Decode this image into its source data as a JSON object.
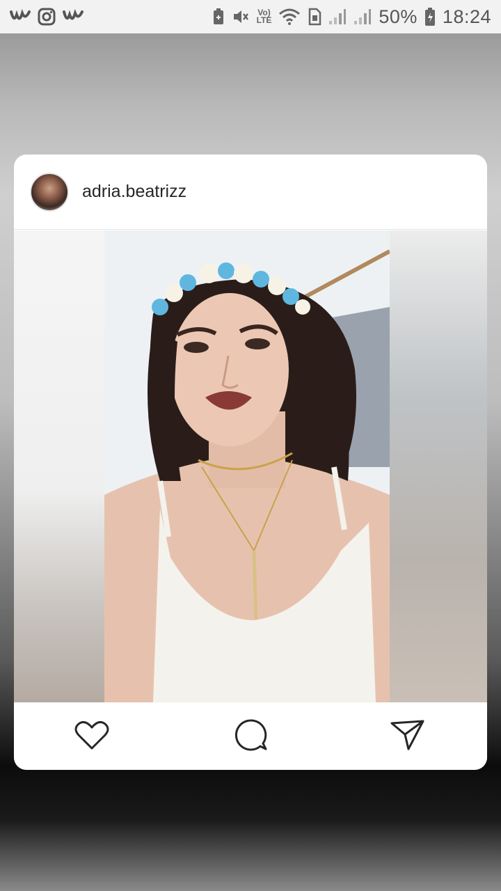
{
  "status_bar": {
    "left_icons": [
      "wish-icon",
      "instagram-icon",
      "wish-icon"
    ],
    "right_icons": [
      "battery-saver-icon",
      "mute-icon",
      "volte-icon",
      "wifi-icon",
      "sim-icon",
      "signal-icon",
      "signal-icon",
      "battery-icon"
    ],
    "volte_top": "Vo)",
    "volte_bottom": "LTE",
    "battery": "50%",
    "time": "18:24"
  },
  "post": {
    "username": "adria.beatrizz",
    "avatar_icon": "profile-avatar",
    "image_description_icon": "post-photo",
    "actions": {
      "like_icon": "heart-icon",
      "comment_icon": "comment-icon",
      "share_icon": "send-icon"
    }
  },
  "colors": {
    "card_bg": "#ffffff",
    "text": "#262626",
    "status_bar_bg": "#f2f2f2"
  }
}
